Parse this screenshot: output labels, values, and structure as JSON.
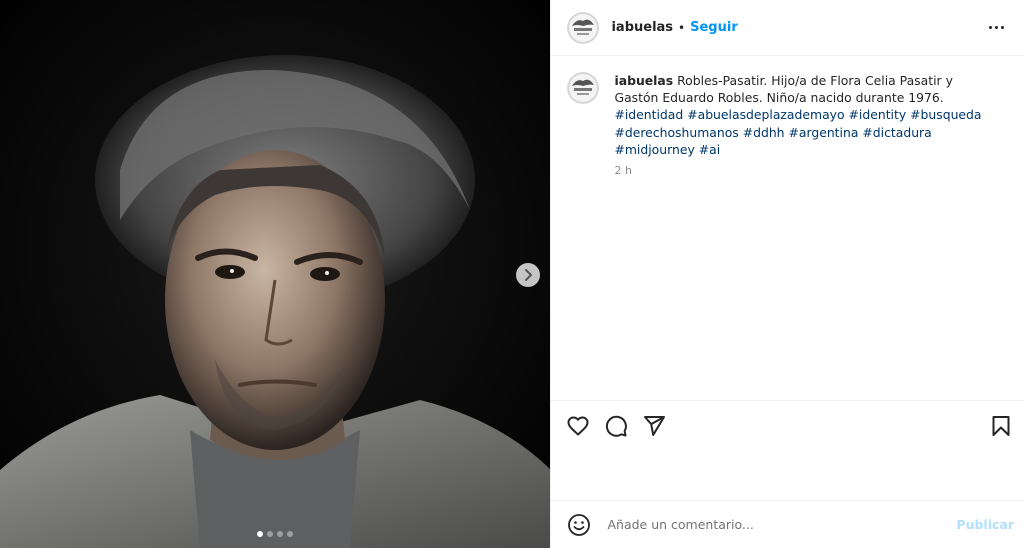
{
  "header": {
    "username": "iabuelas",
    "separator": "•",
    "follow_label": "Seguir"
  },
  "caption": {
    "username": "iabuelas",
    "text": "Robles-Pasatir. Hijo/a de Flora Celia Pasatir y Gastón Eduardo Robles. Niño/a nacido durante 1976.",
    "hashtags": [
      "#identidad",
      "#abuelasdeplazademayo",
      "#identity",
      "#busqueda",
      "#derechoshumanos",
      "#ddhh",
      "#argentina",
      "#dictadura",
      "#midjourney",
      "#ai"
    ],
    "time": "2 h"
  },
  "comment_box": {
    "placeholder": "Añade un comentario...",
    "publish_label": "Publicar"
  },
  "carousel": {
    "slide_count": 4,
    "current_slide": 1
  },
  "icons": {
    "more": "more-horizontal-icon",
    "next": "chevron-right-icon",
    "like": "heart-icon",
    "comment": "comment-icon",
    "share": "send-icon",
    "save": "bookmark-icon",
    "emoji": "emoji-icon"
  },
  "colors": {
    "accent": "#0095f6",
    "hashtag": "#00376b",
    "publish_disabled": "#b2dffc",
    "time": "#8e8e8e"
  }
}
